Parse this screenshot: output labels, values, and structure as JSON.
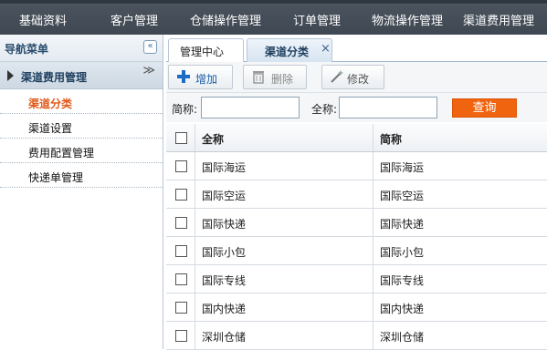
{
  "topnav": {
    "items": [
      {
        "label": "基础资料"
      },
      {
        "label": "客户管理"
      },
      {
        "label": "仓储操作管理"
      },
      {
        "label": "订单管理"
      },
      {
        "label": "物流操作管理"
      },
      {
        "label": "渠道费用管理"
      }
    ]
  },
  "sidebar": {
    "title": "导航菜单",
    "collapse_icon": "«",
    "group": {
      "label": "渠道费用管理",
      "chevron": "≫"
    },
    "items": [
      {
        "label": "渠道分类",
        "active": true
      },
      {
        "label": "渠道设置"
      },
      {
        "label": "费用配置管理"
      },
      {
        "label": "快递单管理"
      }
    ]
  },
  "tabs": {
    "home": "管理中心",
    "active": "渠道分类",
    "close": "×"
  },
  "toolbar": {
    "add": "增加",
    "delete": "删除",
    "edit": "修改"
  },
  "search": {
    "short_label": "简称:",
    "full_label": "全称:",
    "short_value": "",
    "full_value": "",
    "button": "查询"
  },
  "table": {
    "columns": [
      "全称",
      "简称"
    ],
    "rows": [
      {
        "full": "国际海运",
        "short": "国际海运"
      },
      {
        "full": "国际空运",
        "short": "国际空运"
      },
      {
        "full": "国际快递",
        "short": "国际快递"
      },
      {
        "full": "国际小包",
        "short": "国际小包"
      },
      {
        "full": "国际专线",
        "short": "国际专线"
      },
      {
        "full": "国内快递",
        "short": "国内快递"
      },
      {
        "full": "深圳仓储",
        "short": "深圳仓储"
      }
    ]
  },
  "colors": {
    "topbar": "#3f4852",
    "accent_orange": "#f0640f",
    "active_menu": "#e05a1b",
    "link_blue": "#1a5ea8"
  }
}
